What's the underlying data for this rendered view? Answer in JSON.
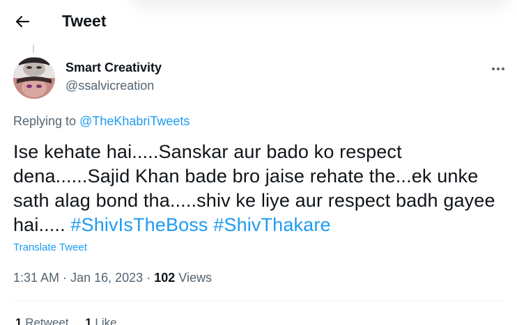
{
  "header": {
    "title": "Tweet"
  },
  "author": {
    "name": "Smart Creativity",
    "handle": "@ssalvicreation"
  },
  "replying": {
    "prefix": "Replying to ",
    "mention": "@TheKhabriTweets"
  },
  "tweet": {
    "text": "Ise kehate hai.....Sanskar aur bado ko respect dena......Sajid Khan bade bro jaise rehate the...ek unke sath alag bond tha.....shiv ke liye aur respect badh gayee hai..... ",
    "hashtags": [
      "#ShivIsTheBoss",
      "#ShivThakare"
    ]
  },
  "translate_label": "Translate Tweet",
  "meta": {
    "time": "1:31 AM",
    "date": "Jan 16, 2023",
    "views_count": "102",
    "views_label": "Views"
  },
  "stats": {
    "retweets_count": "1",
    "retweets_label": "Retweet",
    "likes_count": "1",
    "likes_label": "Like"
  },
  "icons": {
    "back": "arrow-left-icon",
    "more": "more-horizontal-icon"
  }
}
